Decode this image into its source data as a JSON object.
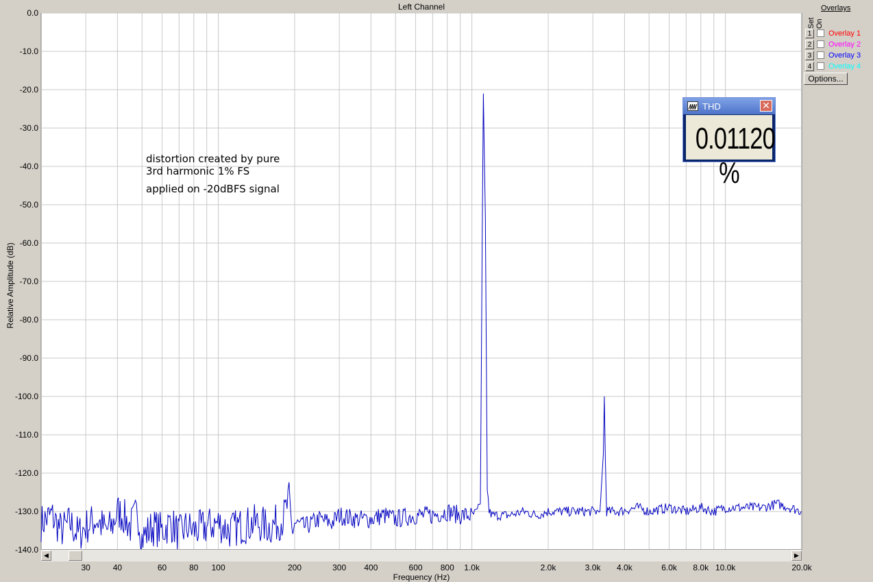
{
  "chart_data": {
    "type": "line",
    "title": "Left Channel",
    "xlabel": "Frequency (Hz)",
    "ylabel": "Relative Amplitude (dB)",
    "x_scale": "log",
    "xlim": [
      20,
      20000
    ],
    "ylim": [
      -140,
      0
    ],
    "yticks": [
      0,
      -10,
      -20,
      -30,
      -40,
      -50,
      -60,
      -70,
      -80,
      -90,
      -100,
      -110,
      -120,
      -130,
      -140
    ],
    "ytick_labels": [
      "0.0",
      "-10.0",
      "-20.0",
      "-30.0",
      "-40.0",
      "-50.0",
      "-60.0",
      "-70.0",
      "-80.0",
      "-90.0",
      "-100.0",
      "-110.0",
      "-120.0",
      "-130.0",
      "-140.0"
    ],
    "xticks": [
      30,
      40,
      60,
      80,
      100,
      200,
      300,
      400,
      600,
      800,
      1000,
      2000,
      3000,
      4000,
      6000,
      8000,
      10000,
      20000
    ],
    "xtick_labels": [
      "30",
      "40",
      "60",
      "80",
      "100",
      "200",
      "300",
      "400",
      "600",
      "800",
      "1.0k",
      "2.0k",
      "3.0k",
      "4.0k",
      "6.0k",
      "8.0k",
      "10.0k",
      "20.0k"
    ],
    "grid": true,
    "series": [
      {
        "color": "#0000c0",
        "noise_floor_db": -131,
        "peaks": [
          {
            "freq": 1110,
            "db": -21
          },
          {
            "freq": 3330,
            "db": -100
          }
        ],
        "points": [
          [
            20,
            -133
          ],
          [
            22,
            -131
          ],
          [
            24,
            -135
          ],
          [
            26,
            -133
          ],
          [
            28,
            -136
          ],
          [
            30,
            -134
          ],
          [
            33,
            -132
          ],
          [
            36,
            -135
          ],
          [
            38,
            -134
          ],
          [
            40,
            -130
          ],
          [
            42,
            -131
          ],
          [
            45,
            -134
          ],
          [
            48,
            -130
          ],
          [
            50,
            -137
          ],
          [
            55,
            -134
          ],
          [
            60,
            -135
          ],
          [
            65,
            -133
          ],
          [
            70,
            -136
          ],
          [
            75,
            -134
          ],
          [
            80,
            -135
          ],
          [
            90,
            -134
          ],
          [
            100,
            -133
          ],
          [
            110,
            -135
          ],
          [
            120,
            -134
          ],
          [
            140,
            -133
          ],
          [
            160,
            -134
          ],
          [
            180,
            -132
          ],
          [
            190,
            -127
          ],
          [
            195,
            -135
          ],
          [
            200,
            -133
          ],
          [
            220,
            -134
          ],
          [
            250,
            -132
          ],
          [
            280,
            -133
          ],
          [
            300,
            -131
          ],
          [
            350,
            -132
          ],
          [
            400,
            -132
          ],
          [
            450,
            -131
          ],
          [
            500,
            -132
          ],
          [
            600,
            -131
          ],
          [
            700,
            -131
          ],
          [
            800,
            -130
          ],
          [
            900,
            -131
          ],
          [
            1000,
            -131
          ],
          [
            1050,
            -130
          ],
          [
            1080,
            -128
          ],
          [
            1100,
            -54
          ],
          [
            1110,
            -21
          ],
          [
            1120,
            -37
          ],
          [
            1130,
            -53
          ],
          [
            1150,
            -124
          ],
          [
            1170,
            -130
          ],
          [
            1200,
            -131
          ],
          [
            1400,
            -131
          ],
          [
            1600,
            -130
          ],
          [
            1800,
            -131
          ],
          [
            2000,
            -130
          ],
          [
            2400,
            -130
          ],
          [
            2800,
            -130
          ],
          [
            3200,
            -130
          ],
          [
            3300,
            -115
          ],
          [
            3330,
            -100
          ],
          [
            3360,
            -116
          ],
          [
            3400,
            -130
          ],
          [
            3800,
            -130
          ],
          [
            4500,
            -129
          ],
          [
            5000,
            -130
          ],
          [
            6000,
            -129
          ],
          [
            7000,
            -130
          ],
          [
            8000,
            -129
          ],
          [
            9000,
            -130
          ],
          [
            10000,
            -129
          ],
          [
            12000,
            -129
          ],
          [
            14000,
            -129
          ],
          [
            16000,
            -128
          ],
          [
            18000,
            -129
          ],
          [
            20000,
            -130
          ]
        ]
      }
    ],
    "annotations": [
      "distortion created by pure",
      "3rd harmonic 1% FS",
      "applied on -20dBFS signal"
    ]
  },
  "overlays": {
    "title": "Overlays",
    "set_label": "Set",
    "on_label": "On",
    "items": [
      {
        "num": "1",
        "label": "Overlay 1",
        "color": "#ff0000"
      },
      {
        "num": "2",
        "label": "Overlay 2",
        "color": "#ff00ff"
      },
      {
        "num": "3",
        "label": "Overlay 3",
        "color": "#0000ff"
      },
      {
        "num": "4",
        "label": "Overlay 4",
        "color": "#00ffff"
      }
    ],
    "options_label": "Options..."
  },
  "thd_window": {
    "title": "THD",
    "value": "0.01120 %"
  }
}
